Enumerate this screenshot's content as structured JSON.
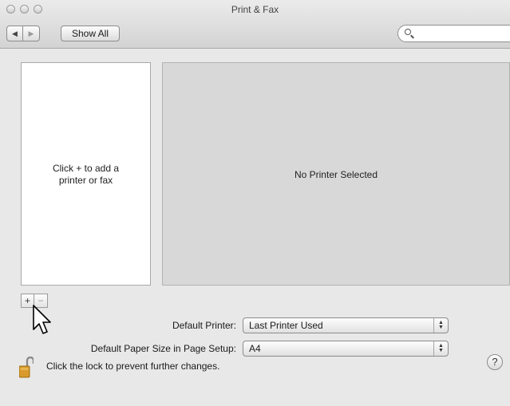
{
  "window": {
    "title": "Print & Fax"
  },
  "toolbar": {
    "back_icon": "triangle-left-icon",
    "forward_icon": "triangle-right-icon",
    "show_all_label": "Show All",
    "search": {
      "value": "",
      "placeholder": ""
    }
  },
  "printer_list": {
    "hint": "Click + to add a printer or fax",
    "add_label": "+",
    "remove_label": "−"
  },
  "detail": {
    "empty_text": "No Printer Selected"
  },
  "settings": {
    "default_printer_label": "Default Printer:",
    "default_printer_value": "Last Printer Used",
    "paper_size_label": "Default Paper Size in Page Setup:",
    "paper_size_value": "A4"
  },
  "footer": {
    "lock_text": "Click the lock to prevent further changes.",
    "help_label": "?"
  }
}
